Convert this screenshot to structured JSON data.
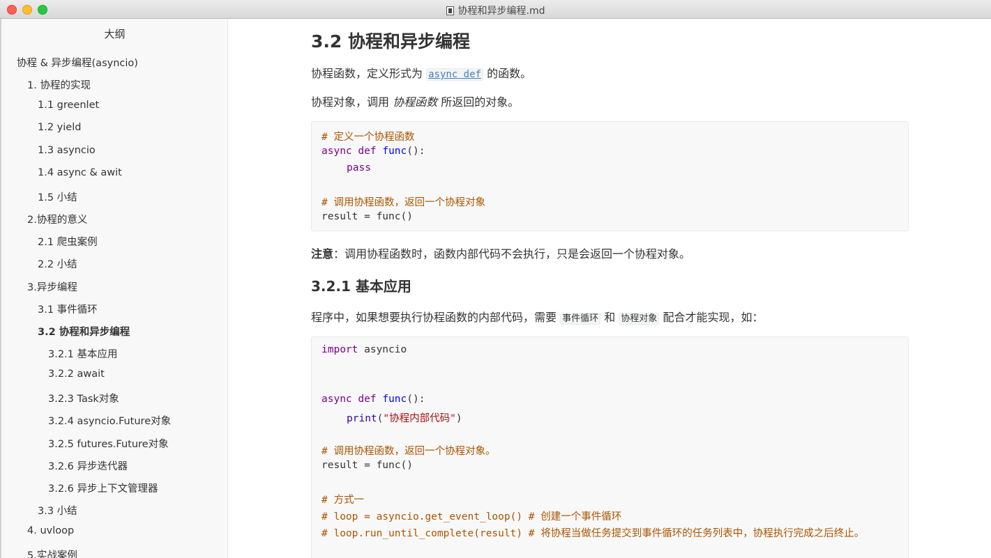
{
  "window": {
    "title": "协程和异步编程.md"
  },
  "sidebar": {
    "title": "大纲",
    "items": [
      {
        "label": "协程 & 异步编程(asyncio)",
        "level": 0
      },
      {
        "label": "1. 协程的实现",
        "level": 1
      },
      {
        "label": "1.1 greenlet",
        "level": 2
      },
      {
        "label": "1.2 yield",
        "level": 2
      },
      {
        "label": "1.3 asyncio",
        "level": 2
      },
      {
        "label": "1.4 async & awit",
        "level": 2
      },
      {
        "label": "1.5 小结",
        "level": 2
      },
      {
        "label": "2.协程的意义",
        "level": 1
      },
      {
        "label": "2.1 爬虫案例",
        "level": 2
      },
      {
        "label": "2.2 小结",
        "level": 2
      },
      {
        "label": "3.异步编程",
        "level": 1
      },
      {
        "label": "3.1 事件循环",
        "level": 2
      },
      {
        "label": "3.2 协程和异步编程",
        "level": 2,
        "active": true
      },
      {
        "label": "3.2.1 基本应用",
        "level": 3
      },
      {
        "label": "3.2.2 await",
        "level": 3
      },
      {
        "label": "3.2.3 Task对象",
        "level": 3
      },
      {
        "label": "3.2.4 asyncio.Future对象",
        "level": 3
      },
      {
        "label": "3.2.5 futures.Future对象",
        "level": 3
      },
      {
        "label": "3.2.6 异步迭代器",
        "level": 3
      },
      {
        "label": "3.2.6 异步上下文管理器",
        "level": 3
      },
      {
        "label": "3.3 小结",
        "level": 2
      },
      {
        "label": "4. uvloop",
        "level": 1
      },
      {
        "label": "5.实战案例",
        "level": 1
      }
    ]
  },
  "content": {
    "heading": "3.2 协程和异步编程",
    "p1_before": "协程函数，定义形式为",
    "p1_code": "async def",
    "p1_after": "的函数。",
    "p2_before": "协程对象，调用",
    "p2_em": "协程函数",
    "p2_after": "所返回的对象。",
    "code1": {
      "line1": "# 定义一个协程函数",
      "line2_kw": "async def",
      "line2_fn": "func",
      "line2_rest": "():",
      "line3": "pass",
      "line5": "# 调用协程函数，返回一个协程对象",
      "line6": "result = func()"
    },
    "note_bold": "注意",
    "note_text": "：调用协程函数时，函数内部代码不会执行，只是会返回一个协程对象。",
    "subheading": "3.2.1 基本应用",
    "p3_before": "程序中，如果想要执行协程函数的内部代码，需要",
    "p3_code1": "事件循环",
    "p3_mid": "和",
    "p3_code2": "协程对象",
    "p3_after": "配合才能实现，如：",
    "code2": {
      "line1_kw": "import",
      "line1_rest": " asyncio",
      "line4_kw": "async def",
      "line4_fn": "func",
      "line4_rest": "():",
      "line5_builtin": "print",
      "line5_open": "(",
      "line5_str": "\"协程内部代码\"",
      "line5_close": ")",
      "line7": "# 调用协程函数，返回一个协程对象。",
      "line8": "result = func()",
      "line10": "# 方式一",
      "line11": "# loop = asyncio.get_event_loop() # 创建一个事件循环",
      "line12": "# loop.run_until_complete(result) # 将协程当做任务提交到事件循环的任务列表中，协程执行完成之后终止。"
    }
  }
}
